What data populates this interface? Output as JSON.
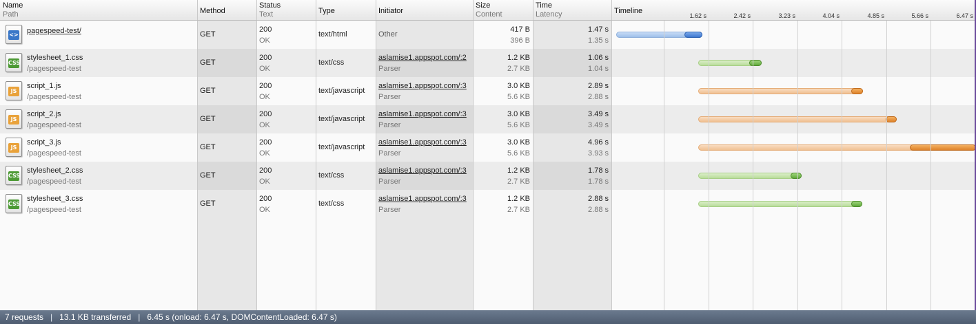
{
  "header": {
    "name": "Name",
    "path": "Path",
    "method": "Method",
    "status": "Status",
    "status_text": "Text",
    "type": "Type",
    "initiator": "Initiator",
    "size": "Size",
    "content": "Content",
    "time": "Time",
    "latency": "Latency",
    "timeline": "Timeline"
  },
  "timeline_ticks": [
    "1.62 s",
    "2.42 s",
    "3.23 s",
    "4.04 s",
    "4.85 s",
    "5.66 s",
    "6.47 s"
  ],
  "timeline_scale_max_s": 6.47,
  "rows": [
    {
      "icon": "html-file-icon",
      "badge": "<>",
      "badge_class": "html",
      "name": "pagespeed-test/",
      "name_link": true,
      "path": "",
      "method": "GET",
      "status": "200",
      "status_text": "OK",
      "type": "text/html",
      "initiator": "Other",
      "initiator_link": false,
      "initiator_sub": "",
      "size": "417 B",
      "content": "396 B",
      "time": "1.47 s",
      "latency": "1.35 s",
      "color": "blue",
      "start_s": 0.0,
      "latency_end_s": 1.35,
      "end_s": 1.47
    },
    {
      "icon": "css-file-icon",
      "badge": "CSS",
      "badge_class": "css",
      "name": "stylesheet_1.css",
      "name_link": false,
      "path": "/pagespeed-test",
      "method": "GET",
      "status": "200",
      "status_text": "OK",
      "type": "text/css",
      "initiator": "aslamise1.appspot.com/:2",
      "initiator_link": true,
      "initiator_sub": "Parser",
      "size": "1.2 KB",
      "content": "2.7 KB",
      "time": "1.06 s",
      "latency": "1.04 s",
      "color": "green",
      "start_s": 1.47,
      "latency_end_s": 2.51,
      "end_s": 2.53
    },
    {
      "icon": "js-file-icon",
      "badge": "JS",
      "badge_class": "js",
      "name": "script_1.js",
      "name_link": false,
      "path": "/pagespeed-test",
      "method": "GET",
      "status": "200",
      "status_text": "OK",
      "type": "text/javascript",
      "initiator": "aslamise1.appspot.com/:3",
      "initiator_link": true,
      "initiator_sub": "Parser",
      "size": "3.0 KB",
      "content": "5.6 KB",
      "time": "2.89 s",
      "latency": "2.88 s",
      "color": "orange",
      "start_s": 1.48,
      "latency_end_s": 4.36,
      "end_s": 4.37
    },
    {
      "icon": "js-file-icon",
      "badge": "JS",
      "badge_class": "js",
      "name": "script_2.js",
      "name_link": false,
      "path": "/pagespeed-test",
      "method": "GET",
      "status": "200",
      "status_text": "OK",
      "type": "text/javascript",
      "initiator": "aslamise1.appspot.com/:3",
      "initiator_link": true,
      "initiator_sub": "Parser",
      "size": "3.0 KB",
      "content": "5.6 KB",
      "time": "3.49 s",
      "latency": "3.49 s",
      "color": "orange",
      "start_s": 1.48,
      "latency_end_s": 4.97,
      "end_s": 4.97
    },
    {
      "icon": "js-file-icon",
      "badge": "JS",
      "badge_class": "js",
      "name": "script_3.js",
      "name_link": false,
      "path": "/pagespeed-test",
      "method": "GET",
      "status": "200",
      "status_text": "OK",
      "type": "text/javascript",
      "initiator": "aslamise1.appspot.com/:3",
      "initiator_link": true,
      "initiator_sub": "Parser",
      "size": "3.0 KB",
      "content": "5.6 KB",
      "time": "4.96 s",
      "latency": "3.93 s",
      "color": "orange",
      "start_s": 1.48,
      "latency_end_s": 5.41,
      "end_s": 6.44
    },
    {
      "icon": "css-file-icon",
      "badge": "CSS",
      "badge_class": "css",
      "name": "stylesheet_2.css",
      "name_link": false,
      "path": "/pagespeed-test",
      "method": "GET",
      "status": "200",
      "status_text": "OK",
      "type": "text/css",
      "initiator": "aslamise1.appspot.com/:3",
      "initiator_link": true,
      "initiator_sub": "Parser",
      "size": "1.2 KB",
      "content": "2.7 KB",
      "time": "1.78 s",
      "latency": "1.78 s",
      "color": "green",
      "start_s": 1.48,
      "latency_end_s": 3.26,
      "end_s": 3.26
    },
    {
      "icon": "css-file-icon",
      "badge": "CSS",
      "badge_class": "css",
      "name": "stylesheet_3.css",
      "name_link": false,
      "path": "/pagespeed-test",
      "method": "GET",
      "status": "200",
      "status_text": "OK",
      "type": "text/css",
      "initiator": "aslamise1.appspot.com/:3",
      "initiator_link": true,
      "initiator_sub": "Parser",
      "size": "1.2 KB",
      "content": "2.7 KB",
      "time": "2.88 s",
      "latency": "2.88 s",
      "color": "green",
      "start_s": 1.48,
      "latency_end_s": 4.36,
      "end_s": 4.36
    }
  ],
  "status_bar": {
    "requests": "7 requests",
    "transferred": "13.1 KB transferred",
    "timing": "6.45 s (onload: 6.47 s, DOMContentLoaded: 6.47 s)"
  },
  "colors": {
    "status_bar": "#56647a",
    "html_bar": "#3d77cf",
    "css_bar": "#5fa83a",
    "js_bar": "#dd822a"
  }
}
